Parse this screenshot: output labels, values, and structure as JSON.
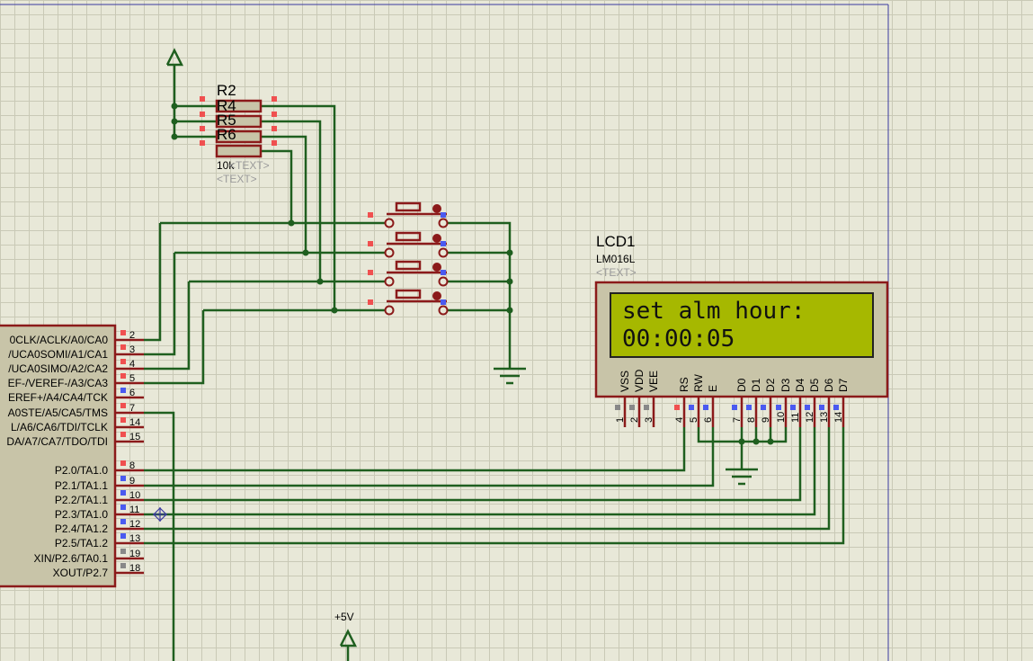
{
  "mcu": {
    "left_pins": [
      {
        "name": "0CLK/ACLK/A0/CA0",
        "num": "2"
      },
      {
        "name": "/UCA0SOMI/A1/CA1",
        "num": "3"
      },
      {
        "name": "/UCA0SIMO/A2/CA2",
        "num": "4"
      },
      {
        "name": "EF-/VEREF-/A3/CA3",
        "num": "5"
      },
      {
        "name": "EREF+/A4/CA4/TCK",
        "num": "6"
      },
      {
        "name": "A0STE/A5/CA5/TMS",
        "num": "7"
      },
      {
        "name": "L/A6/CA6/TDI/TCLK",
        "num": "14"
      },
      {
        "name": "DA/A7/CA7/TDO/TDI",
        "num": "15"
      },
      {
        "name": "P2.0/TA1.0",
        "num": "8"
      },
      {
        "name": "P2.1/TA1.1",
        "num": "9"
      },
      {
        "name": "P2.2/TA1.1",
        "num": "10"
      },
      {
        "name": "P2.3/TA1.0",
        "num": "11"
      },
      {
        "name": "P2.4/TA1.2",
        "num": "12"
      },
      {
        "name": "P2.5/TA1.2",
        "num": "13"
      },
      {
        "name": "XIN/P2.6/TA0.1",
        "num": "19"
      },
      {
        "name": "XOUT/P2.7",
        "num": "18"
      }
    ]
  },
  "resistors": {
    "refs": [
      "R2",
      "R4",
      "R5",
      "R6"
    ],
    "value": "10k",
    "template1": "<TEXT>",
    "template2": "<TEXT>"
  },
  "lcd": {
    "ref": "LCD1",
    "model": "LM016L",
    "template": "<TEXT>",
    "line1": "set alm hour:",
    "line2": "00:00:05",
    "pin_names": [
      "VSS",
      "VDD",
      "VEE",
      "RS",
      "RW",
      "E",
      "D0",
      "D1",
      "D2",
      "D3",
      "D4",
      "D5",
      "D6",
      "D7"
    ],
    "pin_nums": [
      "1",
      "2",
      "3",
      "4",
      "5",
      "6",
      "7",
      "8",
      "9",
      "10",
      "11",
      "12",
      "13",
      "14"
    ]
  },
  "power": {
    "label": "+5V"
  },
  "colors": {
    "wire": "#1f5f1f",
    "component": "#8b1a1a",
    "lcd_screen": "#a6b800",
    "body_fill": "#c8c4a8"
  }
}
